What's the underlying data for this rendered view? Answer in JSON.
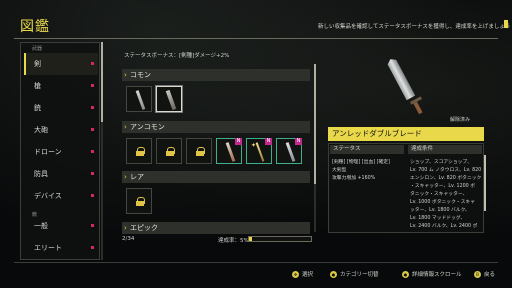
{
  "title": "図鑑",
  "hint": "新しい収集品を確認してステータスボーナスを獲得し、達成率を上げましょう",
  "sidebar": {
    "header_weapon": "武器",
    "items": [
      {
        "label": "剣"
      },
      {
        "label": "槍"
      },
      {
        "label": "銃"
      },
      {
        "label": "大砲"
      },
      {
        "label": "ドローン"
      },
      {
        "label": "防具"
      },
      {
        "label": "デバイス"
      }
    ],
    "header_enemy": "敵",
    "enemy_items": [
      {
        "label": "一般"
      },
      {
        "label": "エリート"
      }
    ]
  },
  "list": {
    "status_bonus": "ステータスボーナス：[剣種]ダメージ+2%",
    "categories": [
      "コモン",
      "アンコモン",
      "レア",
      "エピック"
    ],
    "count": "2/34",
    "rate_label": "達成率：5%",
    "rate_value": 0.05
  },
  "detail": {
    "release": "解除済み",
    "item_name": "アンレッドダブルブレード",
    "status_header": "ステータス",
    "condition_header": "達成条件",
    "status_lines": [
      "[剣種] [物理] [出血] [確定]",
      "大剣型",
      "攻撃力増加 +160%"
    ],
    "condition_lines": [
      "ショップ、スコアショップ、",
      "Lv. 700 ム ノタウロス、Lv. 820",
      "エンシロン、Lv. 820 ボタニック",
      "・スキャッター、Lv. 1200 ボ",
      "タニック・スキャッター、",
      "Lv. 1000 ボタニック・スキャ",
      "ッター、Lv. 1800 バルク、",
      "Lv. 1800 マッドドッグ、",
      "Lv. 2400 バルク、Lv. 2400 ポ"
    ]
  },
  "footer": {
    "select": "選択",
    "category_switch": "カテゴリー切替",
    "detail_scroll": "詳細情報スクロール",
    "back": "戻る"
  },
  "colors": {
    "accent": "#e8d84a",
    "badge": "#c02a8e",
    "dot": "#d8285a"
  }
}
